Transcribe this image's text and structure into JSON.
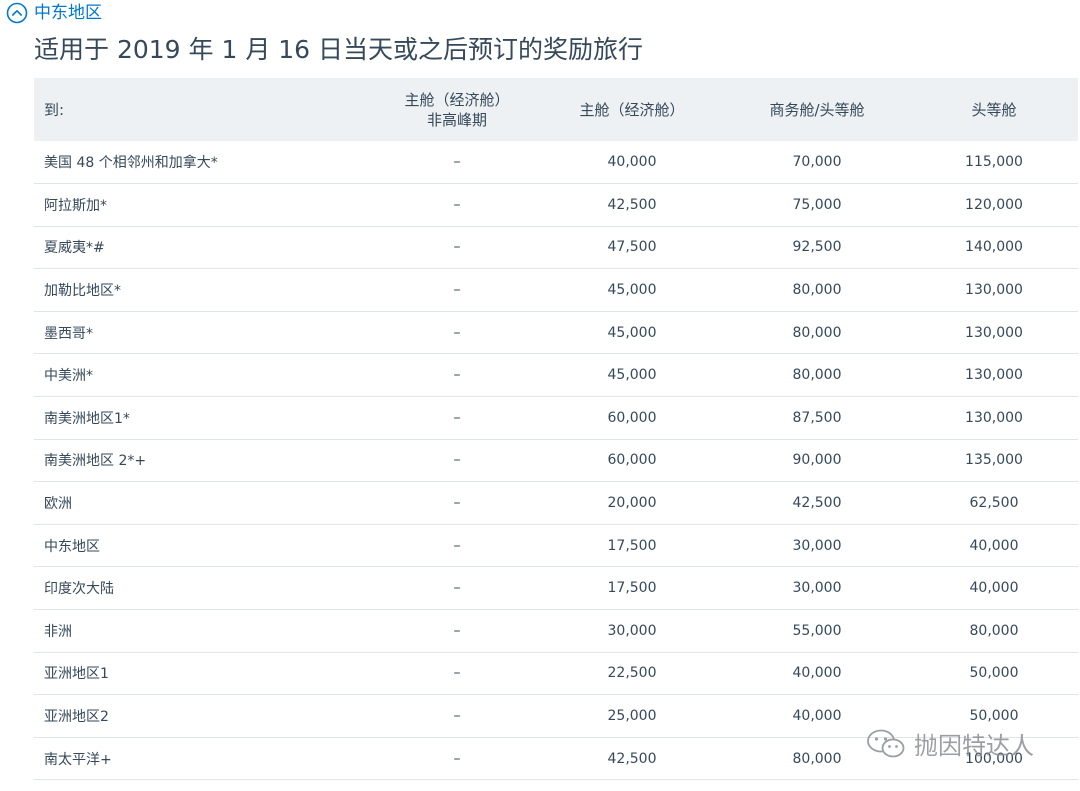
{
  "section": {
    "label": "中东地区",
    "icon": "chevron-up-circle-icon",
    "accent_color": "#0078d2"
  },
  "page": {
    "title": "适用于 2019 年 1 月 16 日当天或之后预订的奖励旅行"
  },
  "table": {
    "headers": [
      "到:",
      "主舱（经济舱）",
      "主舱（经济舱）",
      "商务舱/头等舱",
      "头等舱"
    ],
    "header_sub": [
      "",
      "非高峰期",
      "",
      "",
      ""
    ],
    "rows": [
      [
        "美国 48 个相邻州和加拿大*",
        "–",
        "40,000",
        "70,000",
        "115,000"
      ],
      [
        "阿拉斯加*",
        "–",
        "42,500",
        "75,000",
        "120,000"
      ],
      [
        "夏威夷*#",
        "–",
        "47,500",
        "92,500",
        "140,000"
      ],
      [
        "加勒比地区*",
        "–",
        "45,000",
        "80,000",
        "130,000"
      ],
      [
        "墨西哥*",
        "–",
        "45,000",
        "80,000",
        "130,000"
      ],
      [
        "中美洲*",
        "–",
        "45,000",
        "80,000",
        "130,000"
      ],
      [
        "南美洲地区1*",
        "–",
        "60,000",
        "87,500",
        "130,000"
      ],
      [
        "南美洲地区 2*+",
        "–",
        "60,000",
        "90,000",
        "135,000"
      ],
      [
        "欧洲",
        "–",
        "20,000",
        "42,500",
        "62,500"
      ],
      [
        "中东地区",
        "–",
        "17,500",
        "30,000",
        "40,000"
      ],
      [
        "印度次大陆",
        "–",
        "17,500",
        "30,000",
        "40,000"
      ],
      [
        "非洲",
        "–",
        "30,000",
        "55,000",
        "80,000"
      ],
      [
        "亚洲地区1",
        "–",
        "22,500",
        "40,000",
        "50,000"
      ],
      [
        "亚洲地区2",
        "–",
        "25,000",
        "40,000",
        "50,000"
      ],
      [
        "南太平洋+",
        "–",
        "42,500",
        "80,000",
        "100,000"
      ]
    ]
  },
  "watermark": {
    "text": "抛因特达人",
    "icon": "wechat-icon"
  }
}
